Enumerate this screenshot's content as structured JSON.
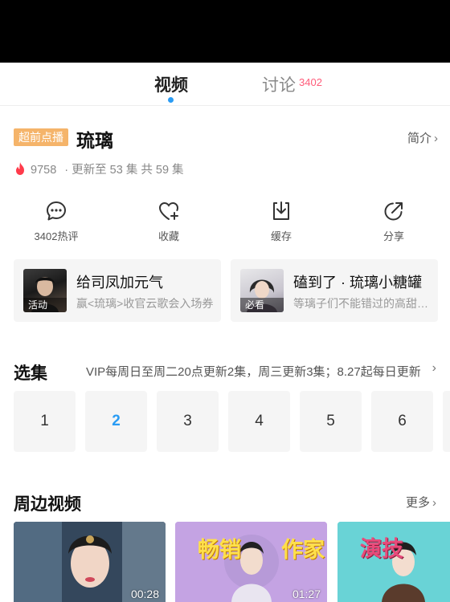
{
  "tabs": {
    "video": "视频",
    "discussion": "讨论",
    "discussion_count": "3402"
  },
  "header": {
    "badge": "超前点播",
    "title": "琉璃",
    "intro_link": "简介",
    "heat": "9758",
    "update_info": "· 更新至 53 集 共 59 集"
  },
  "actions": [
    {
      "icon": "comment-icon",
      "label": "3402热评"
    },
    {
      "icon": "favorite-heart-icon",
      "label": "收藏"
    },
    {
      "icon": "download-icon",
      "label": "缓存"
    },
    {
      "icon": "share-icon",
      "label": "分享"
    }
  ],
  "promo_cards": [
    {
      "tag": "活动",
      "title": "给司凤加元气",
      "subtitle": "赢<琉璃>收官云歌会入场券"
    },
    {
      "tag": "必看",
      "title": "磕到了 · 琉璃小糖罐",
      "subtitle": "等璃子们不能错过的高甜片段"
    }
  ],
  "episodes": {
    "title": "选集",
    "description": "VIP每周日至周二20点更新2集，周三更新3集；8.27起每日更新",
    "items": [
      "1",
      "2",
      "3",
      "4",
      "5",
      "6"
    ],
    "selected": "2"
  },
  "side_videos": {
    "title": "周边视频",
    "more": "更多",
    "items": [
      {
        "duration": "00:28",
        "overlay": ""
      },
      {
        "duration": "01:27",
        "overlay_left": "畅销",
        "overlay_right": "作家"
      },
      {
        "duration": "",
        "overlay_left": "演技"
      }
    ]
  },
  "colors": {
    "accent_blue": "#2a9cf4",
    "badge_orange": "#f5b46a",
    "heat_red": "#ff3b4b",
    "count_pink": "#ff5c7a"
  }
}
